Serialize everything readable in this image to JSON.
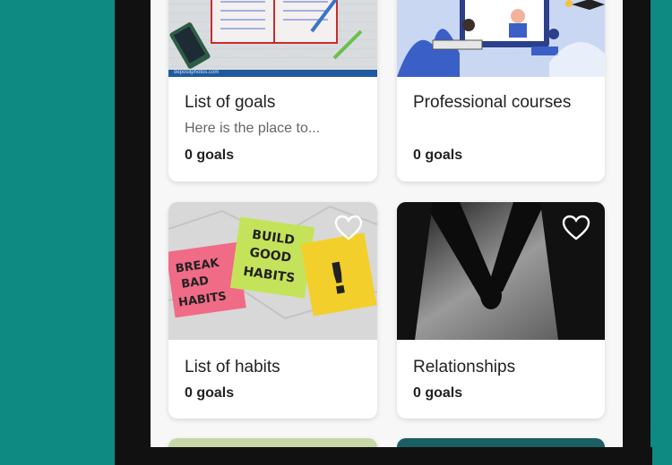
{
  "cards": [
    {
      "title": "List of goals",
      "subtitle": "Here is the place to...",
      "count": "0 goals"
    },
    {
      "title": "Professional courses",
      "subtitle": "",
      "count": "0 goals"
    },
    {
      "title": "List of habits",
      "subtitle": "",
      "count": "0 goals"
    },
    {
      "title": "Relationships",
      "subtitle": "",
      "count": "0 goals"
    }
  ],
  "images": {
    "goals_credit": "depositphotos.com",
    "habits_note_1": "BREAK BAD HABITS",
    "habits_note_2": "BUILD GOOD HABITS",
    "habits_note_3": "!"
  },
  "colors": {
    "background": "#0f8a82",
    "card": "#ffffff",
    "screen": "#f7f7f7"
  }
}
